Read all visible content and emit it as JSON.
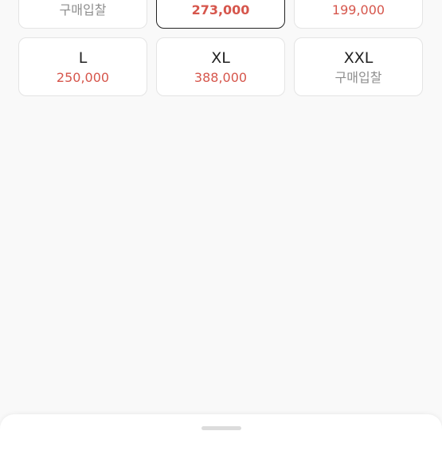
{
  "sizes": [
    {
      "label": "",
      "price": "구매입찰",
      "selected": false
    },
    {
      "label": "",
      "price": "273,000",
      "selected": true
    },
    {
      "label": "",
      "price": "199,000",
      "selected": false
    },
    {
      "label": "L",
      "price": "250,000",
      "selected": false
    },
    {
      "label": "XL",
      "price": "388,000",
      "selected": false
    },
    {
      "label": "XXL",
      "price": "구매입찰",
      "selected": false
    }
  ],
  "colors": {
    "price": "#d6564c",
    "bid_text": "#8e8e8e",
    "selected_border": "#222222",
    "card_border": "#e4e4e4",
    "background": "#f9f9f9"
  }
}
